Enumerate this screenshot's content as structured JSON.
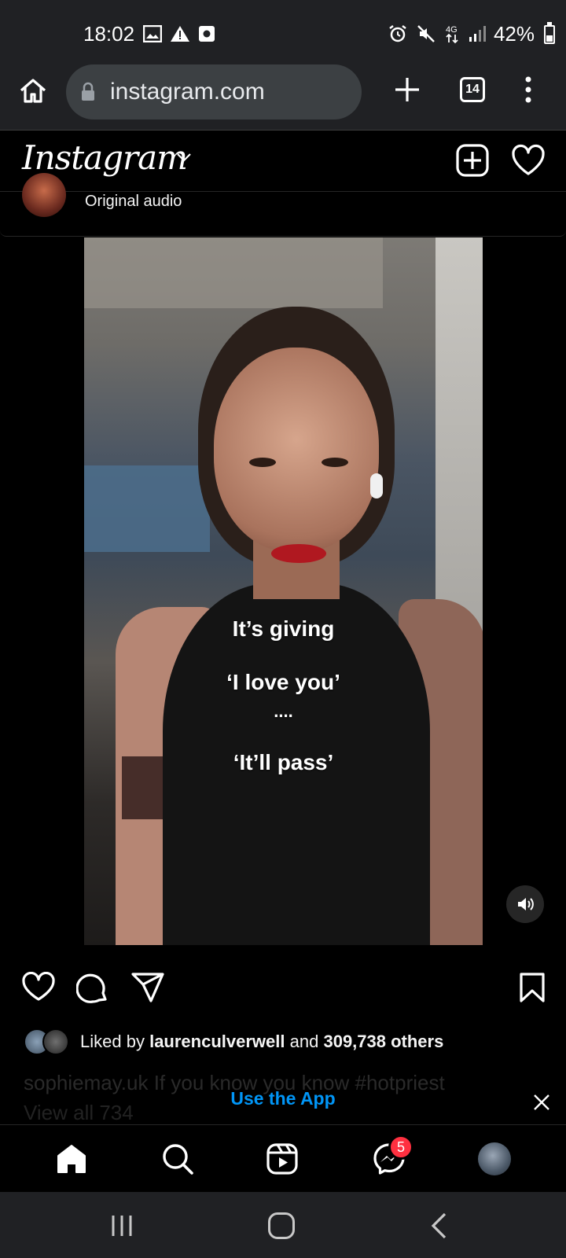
{
  "status_bar": {
    "time": "18:02",
    "battery_percent": "42%",
    "network": "4G",
    "left_icons": [
      "image-icon",
      "warning-icon",
      "record-icon"
    ],
    "right_icons": [
      "alarm-icon",
      "mute-icon",
      "data-icon",
      "signal-icon",
      "battery-icon"
    ]
  },
  "browser": {
    "url": "instagram.com",
    "tab_count": "14"
  },
  "instagram": {
    "logo": "Instagram"
  },
  "post": {
    "audio_label": "Original audio",
    "video_captions": [
      "It’s giving",
      "‘I love you’",
      "....",
      "‘It’ll pass’"
    ],
    "likes": {
      "prefix": "Liked by",
      "user": "laurenculverwell",
      "middle": "and",
      "count": "309,738 others"
    },
    "caption_faded": "sophiemay.uk If you know you know #hotpriest",
    "comments_faded": "View all 734"
  },
  "banner": {
    "use_app": "Use the App"
  },
  "nav": {
    "messenger_badge": "5"
  },
  "colors": {
    "accent_blue": "#0095f6",
    "badge_red": "#ff3040",
    "chrome_bg": "#202124"
  }
}
